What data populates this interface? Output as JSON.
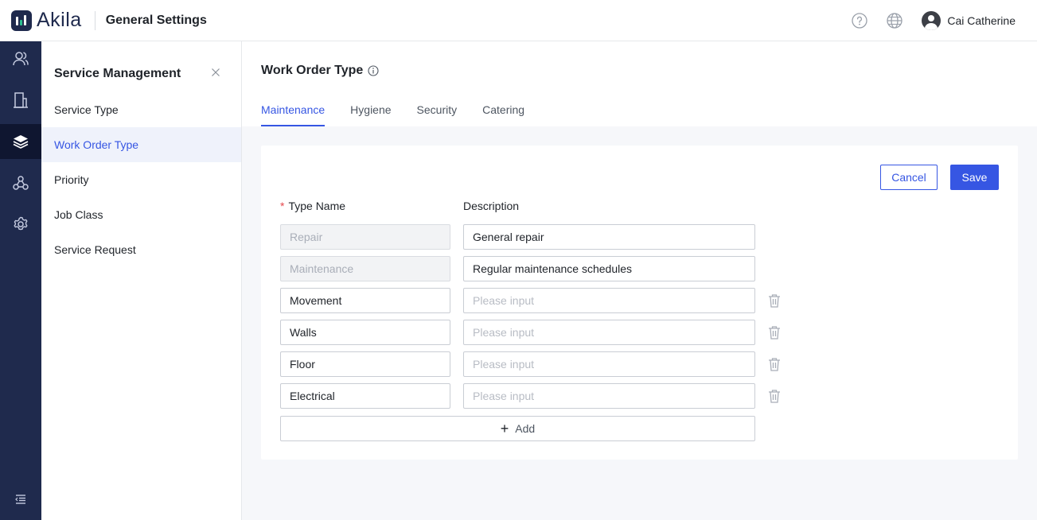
{
  "app": {
    "name": "Akila",
    "title": "General Settings"
  },
  "header": {
    "user_name": "Cai Catherine",
    "help_icon": "help-circle-icon",
    "language_icon": "globe-icon"
  },
  "rail": {
    "items": [
      "users-icon",
      "building-icon",
      "layers-icon",
      "network-icon",
      "settings-icon"
    ],
    "active": "layers-icon",
    "collapse_icon": "collapse-menu-icon"
  },
  "sidebar": {
    "title": "Service Management",
    "items": [
      {
        "label": "Service Type"
      },
      {
        "label": "Work Order Type",
        "active": true
      },
      {
        "label": "Priority"
      },
      {
        "label": "Job Class"
      },
      {
        "label": "Service Request"
      }
    ]
  },
  "main": {
    "title": "Work Order Type",
    "tabs": [
      {
        "label": "Maintenance",
        "active": true
      },
      {
        "label": "Hygiene"
      },
      {
        "label": "Security"
      },
      {
        "label": "Catering"
      }
    ],
    "actions": {
      "cancel": "Cancel",
      "save": "Save"
    },
    "columns": {
      "required_mark": "*",
      "type_name": "Type Name",
      "description": "Description"
    },
    "rows": [
      {
        "name": "Repair",
        "description": "General repair",
        "locked": true
      },
      {
        "name": "Maintenance",
        "description": "Regular maintenance schedules",
        "locked": true
      },
      {
        "name": "Movement",
        "description_placeholder": "Please input"
      },
      {
        "name": "Walls",
        "description_placeholder": "Please input"
      },
      {
        "name": "Floor",
        "description_placeholder": "Please input"
      },
      {
        "name": "Electrical",
        "description_placeholder": "Please input"
      }
    ],
    "add_label": "Add"
  },
  "colors": {
    "accent": "#3656e3",
    "rail_bg": "#1f2a4d",
    "rail_active": "#0f1630",
    "brand_green": "#2bbf8f"
  }
}
